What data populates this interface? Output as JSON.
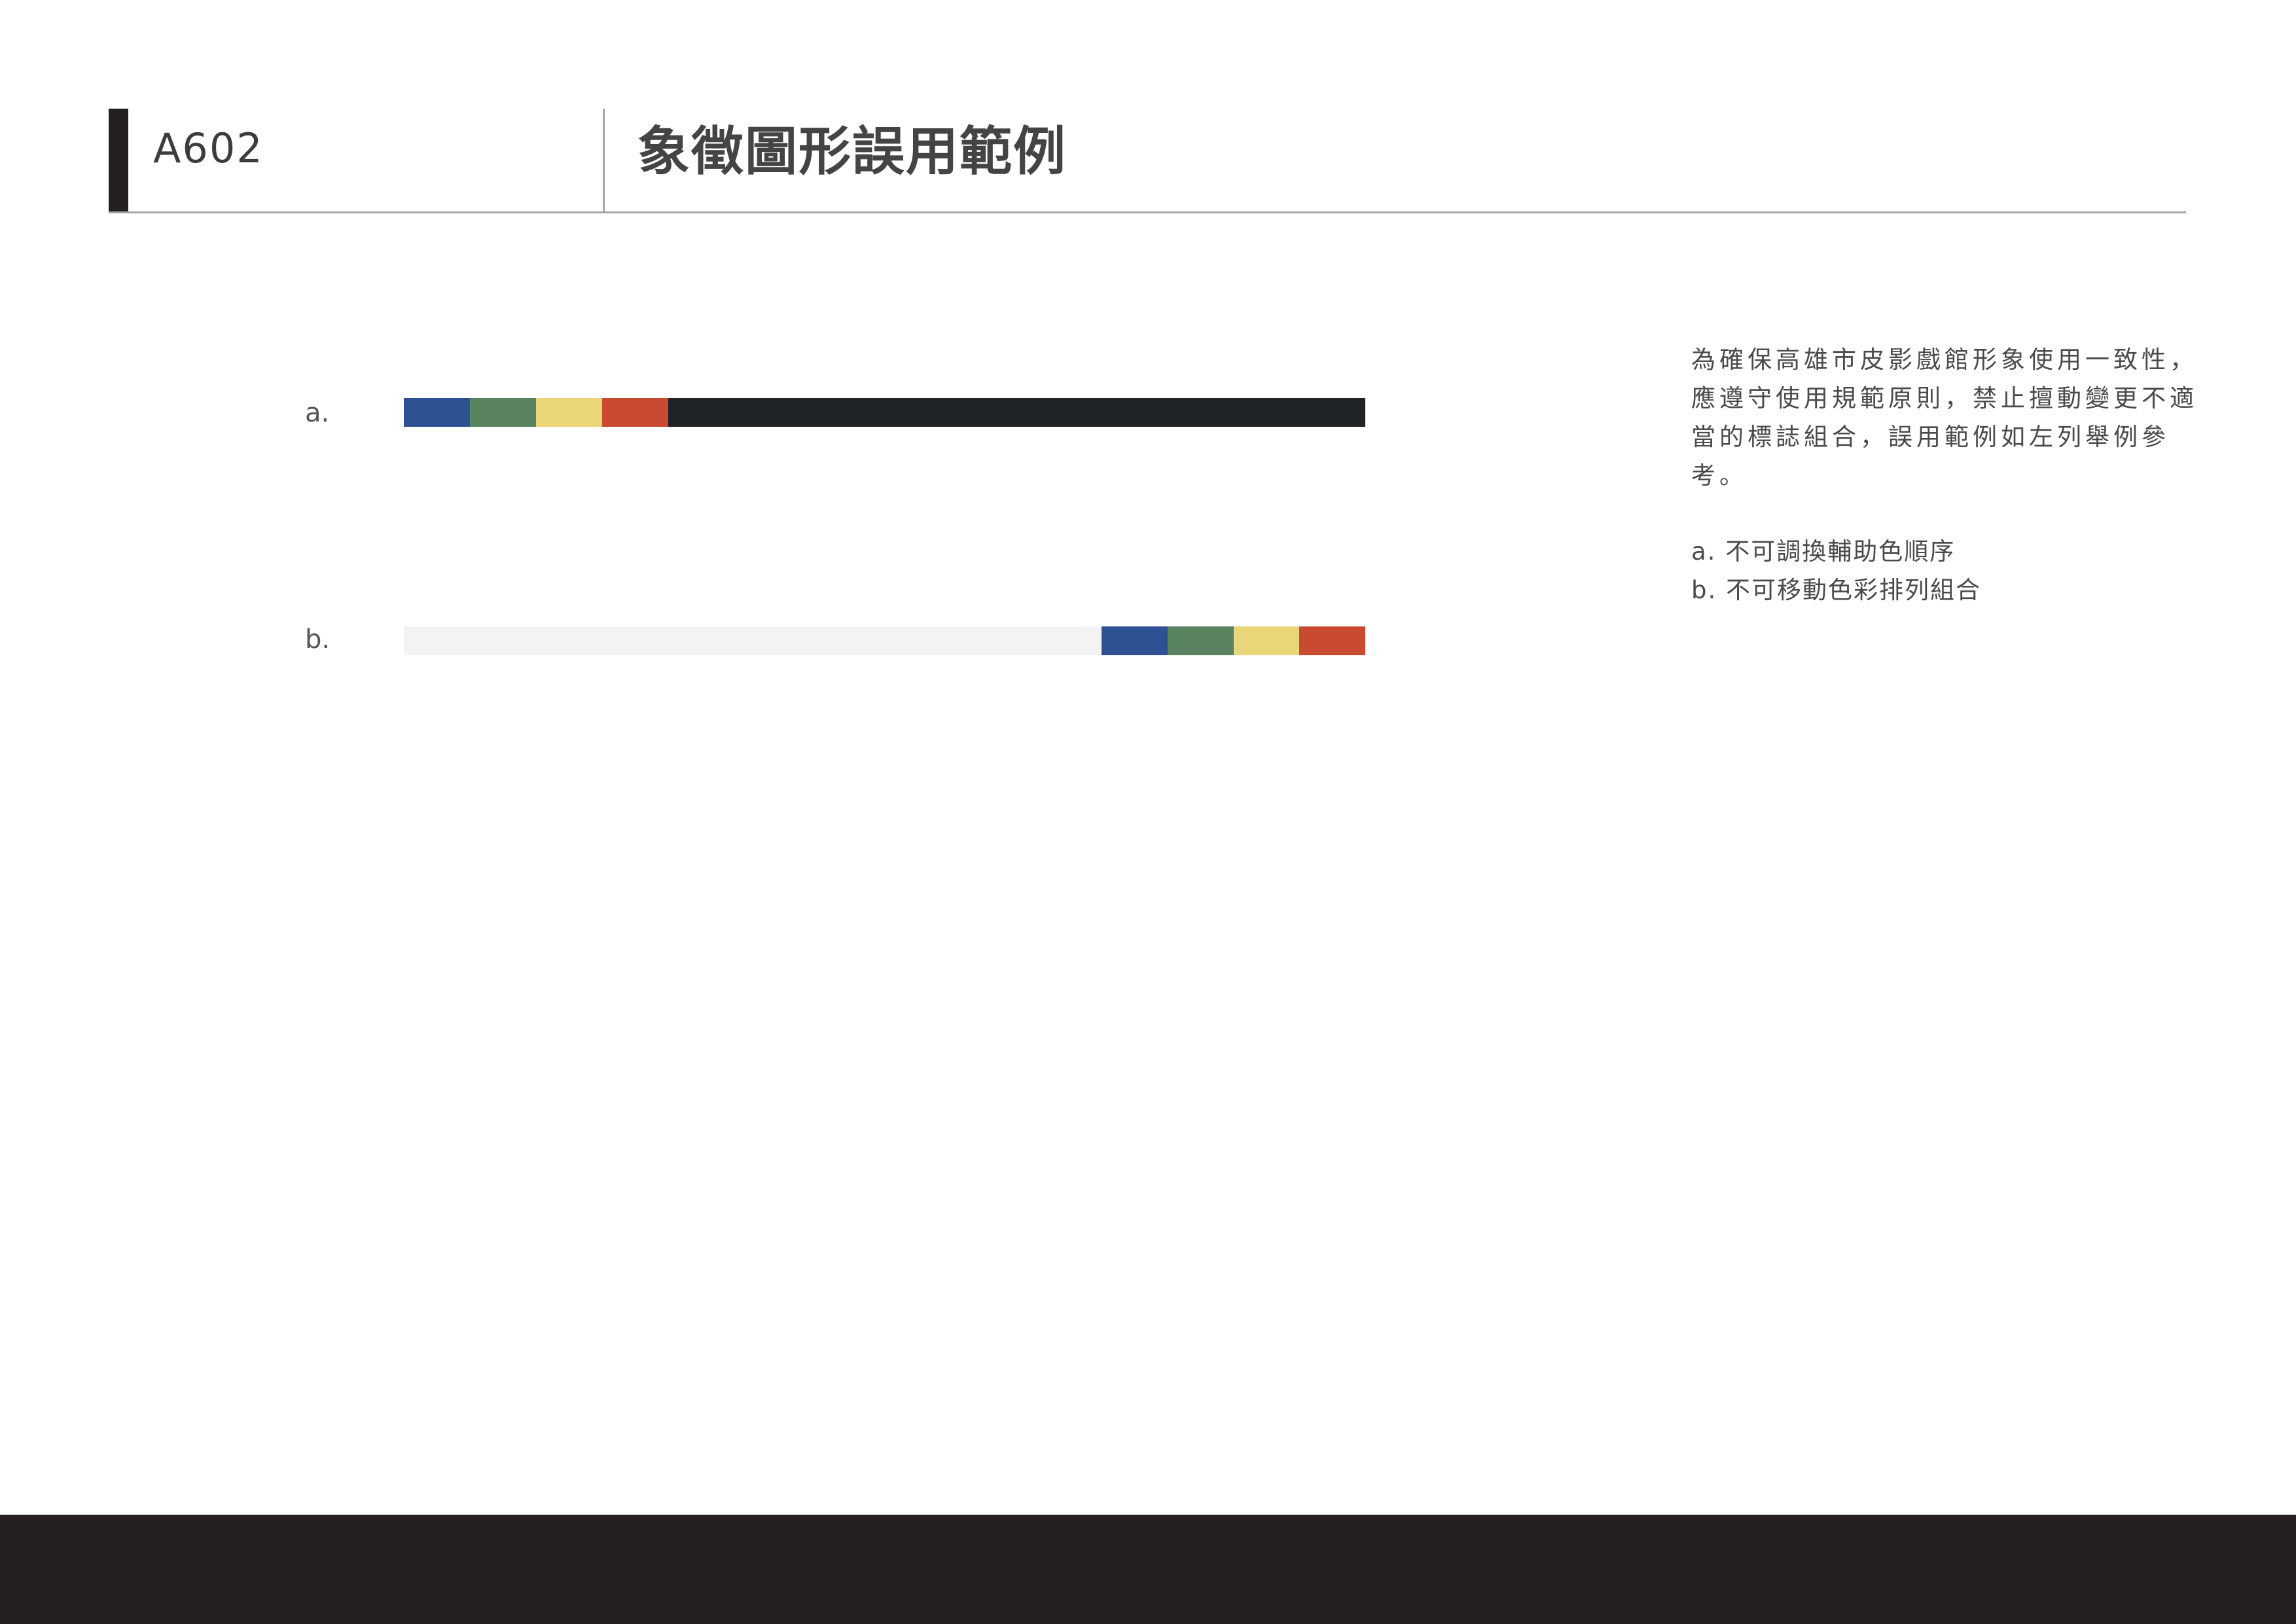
{
  "header": {
    "page_code": "A602",
    "title": "象徵圖形誤用範例"
  },
  "examples": [
    {
      "label": "a.",
      "bar_background": "#1f2326",
      "segments": [
        {
          "color_name": "blue",
          "color": "#2d5193"
        },
        {
          "color_name": "green",
          "color": "#5a8460"
        },
        {
          "color_name": "yellow",
          "color": "#ead678"
        },
        {
          "color_name": "red",
          "color": "#c84b31"
        }
      ]
    },
    {
      "label": "b.",
      "bar_background": "#f3f3f3",
      "segments": [
        {
          "color_name": "blue",
          "color": "#2d5193"
        },
        {
          "color_name": "green",
          "color": "#5a8460"
        },
        {
          "color_name": "yellow",
          "color": "#ead678"
        },
        {
          "color_name": "red",
          "color": "#c84b31"
        }
      ]
    }
  ],
  "description": {
    "lines": [
      "為確保高雄市皮影戲館形象使用一致性，",
      "應遵守使用規範原則，禁止擅動變更不適",
      "當的標誌組合，誤用範例如左列舉例參",
      "考。"
    ],
    "rules": [
      "a. 不可調換輔助色順序",
      "b. 不可移動色彩排列組合"
    ]
  },
  "colors": {
    "footer": "#231f20",
    "accent": "#231f20",
    "divider": "#a6a6a6"
  }
}
